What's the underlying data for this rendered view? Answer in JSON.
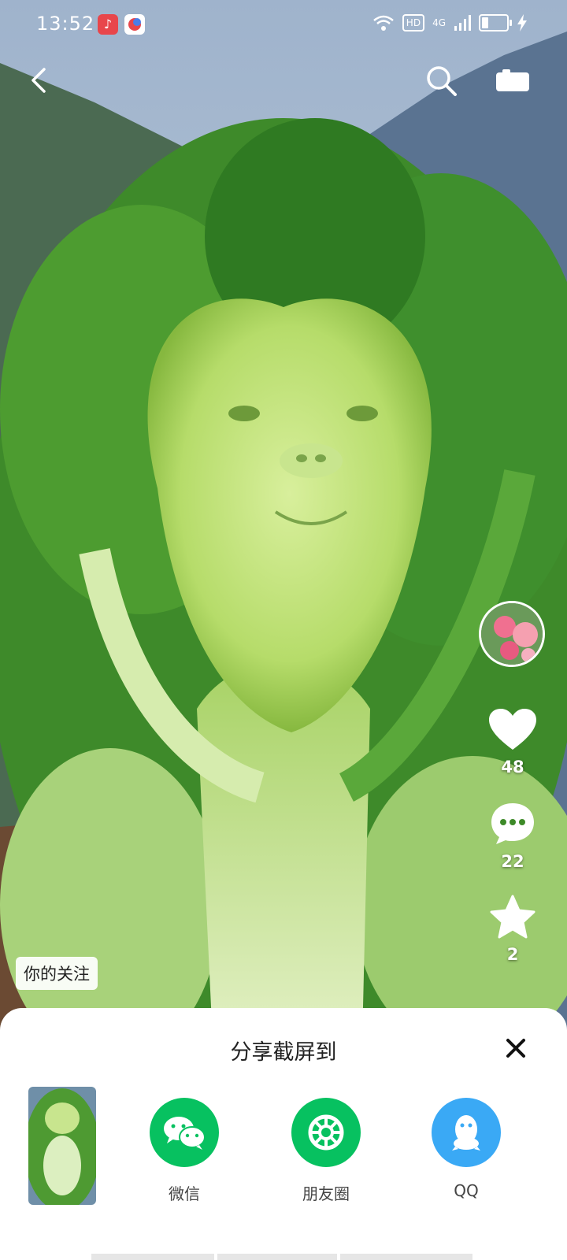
{
  "status_bar": {
    "time": "13:52",
    "hd": "HD",
    "network": "4G"
  },
  "video": {
    "follow_tag": "你的关注",
    "likes": "48",
    "comments": "22",
    "favorites": "2"
  },
  "icons": [
    "back-icon",
    "search-icon",
    "camera-icon",
    "heart-icon",
    "comment-icon",
    "star-icon",
    "close-icon",
    "wechat-icon",
    "moments-icon",
    "qq-icon"
  ],
  "share_sheet": {
    "title": "分享截屏到",
    "targets": [
      {
        "label": "微信",
        "color": "#07c160"
      },
      {
        "label": "朋友圈",
        "color": "#07c160"
      },
      {
        "label": "QQ",
        "color": "#3aa9f5"
      }
    ]
  }
}
